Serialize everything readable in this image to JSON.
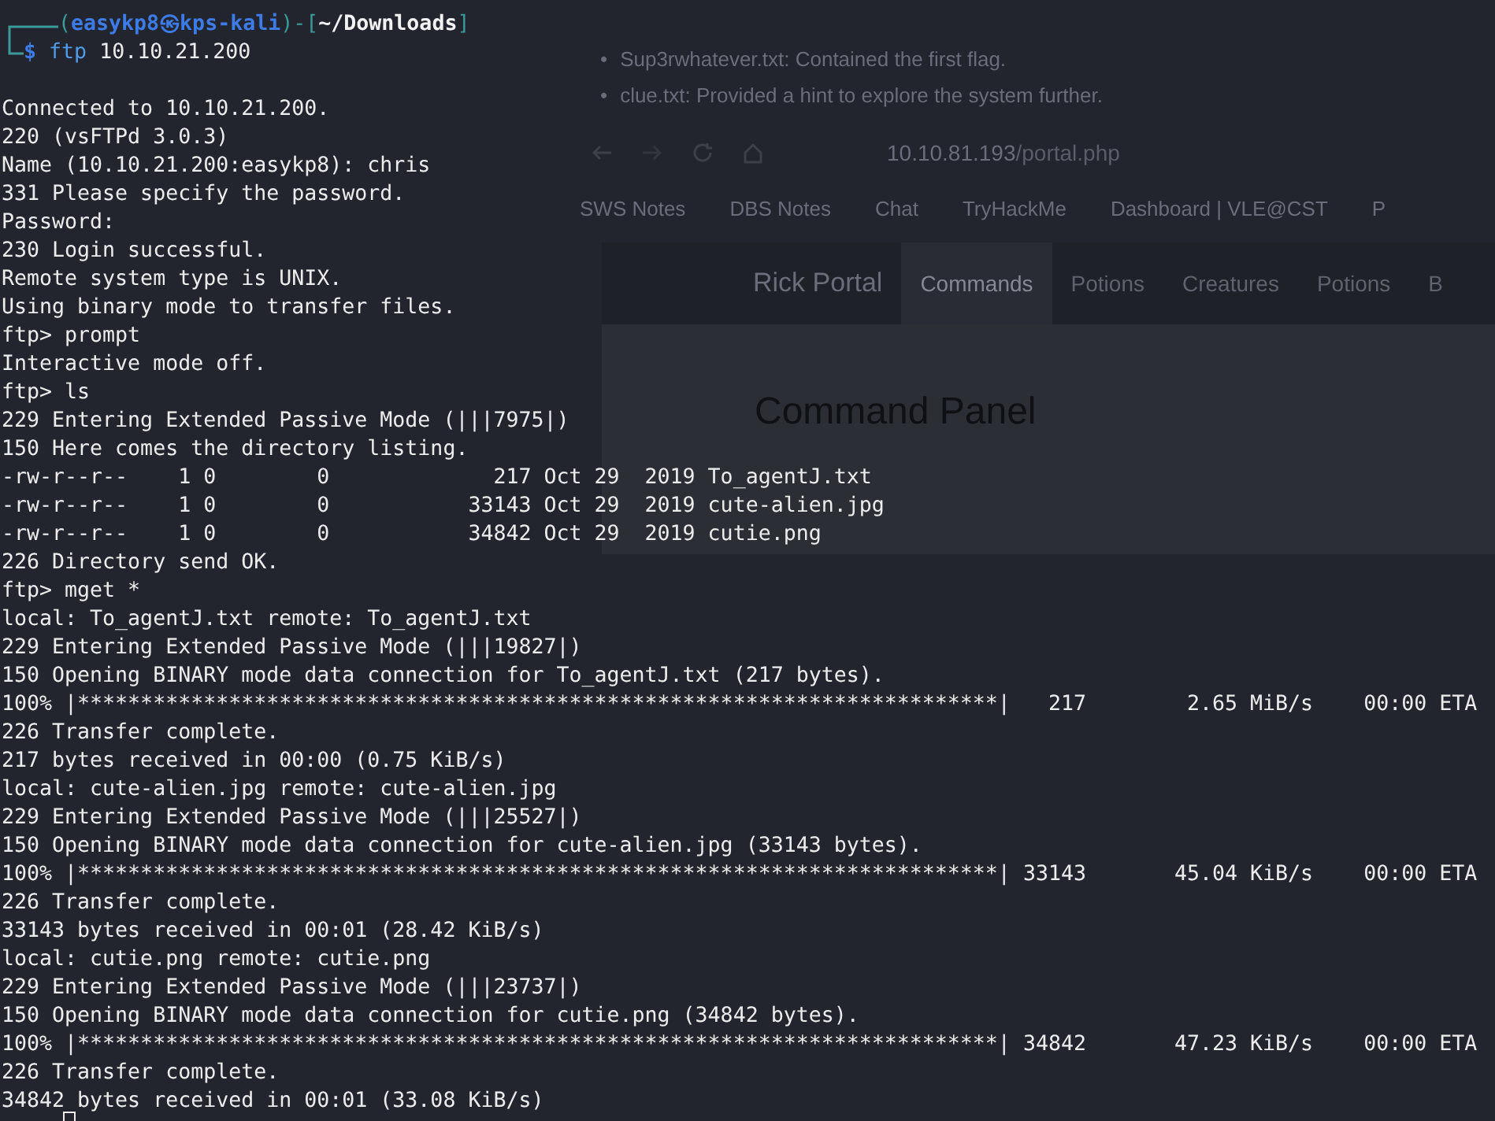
{
  "background_window": {
    "bullet_marker": "•",
    "bullets": [
      "Sup3rwhatever.txt: Contained the first flag.",
      "clue.txt: Provided a hint to explore the system further."
    ],
    "url": {
      "host": "10.10.81.193",
      "path": "/portal.php"
    },
    "bookmarks": [
      "SWS Notes",
      "DBS Notes",
      "Chat",
      "TryHackMe",
      "Dashboard | VLE@CST",
      "P"
    ],
    "site_title": "Rick Portal",
    "nav_tabs": [
      {
        "label": "Commands",
        "selected": true
      },
      {
        "label": "Potions",
        "selected": false
      },
      {
        "label": "Creatures",
        "selected": false
      },
      {
        "label": "Potions",
        "selected": false
      },
      {
        "label": "B",
        "selected": false
      }
    ],
    "panel_heading": "Command Panel"
  },
  "prompt": {
    "parts": [
      {
        "kind": "punct",
        "text": "("
      },
      {
        "kind": "user",
        "text": "easykp8㉿kps-kali"
      },
      {
        "kind": "punct",
        "text": ")-["
      },
      {
        "kind": "path",
        "text": "~/Downloads"
      },
      {
        "kind": "punct",
        "text": "]"
      }
    ],
    "symbol": "$",
    "command": "ftp",
    "args": "10.10.21.200"
  },
  "output": [
    "Connected to 10.10.21.200.",
    "220 (vsFTPd 3.0.3)",
    "Name (10.10.21.200:easykp8): chris",
    "331 Please specify the password.",
    "Password:",
    "230 Login successful.",
    "Remote system type is UNIX.",
    "Using binary mode to transfer files.",
    "ftp> prompt",
    "Interactive mode off.",
    "ftp> ls",
    "229 Entering Extended Passive Mode (|||7975|)",
    "150 Here comes the directory listing.",
    "-rw-r--r--    1 0        0             217 Oct 29  2019 To_agentJ.txt",
    "-rw-r--r--    1 0        0           33143 Oct 29  2019 cute-alien.jpg",
    "-rw-r--r--    1 0        0           34842 Oct 29  2019 cutie.png",
    "226 Directory send OK.",
    "ftp> mget *",
    "local: To_agentJ.txt remote: To_agentJ.txt",
    "229 Entering Extended Passive Mode (|||19827|)",
    "150 Opening BINARY mode data connection for To_agentJ.txt (217 bytes).",
    "100% |*************************************************************************|   217        2.65 MiB/s    00:00 ETA",
    "226 Transfer complete.",
    "217 bytes received in 00:00 (0.75 KiB/s)",
    "local: cute-alien.jpg remote: cute-alien.jpg",
    "229 Entering Extended Passive Mode (|||25527|)",
    "150 Opening BINARY mode data connection for cute-alien.jpg (33143 bytes).",
    "100% |*************************************************************************| 33143       45.04 KiB/s    00:00 ETA",
    "226 Transfer complete.",
    "33143 bytes received in 00:01 (28.42 KiB/s)",
    "local: cutie.png remote: cutie.png",
    "229 Entering Extended Passive Mode (|||23737|)",
    "150 Opening BINARY mode data connection for cutie.png (34842 bytes).",
    "100% |*************************************************************************| 34842       47.23 KiB/s    00:00 ETA",
    "226 Transfer complete.",
    "34842 bytes received in 00:01 (33.08 KiB/s)"
  ]
}
